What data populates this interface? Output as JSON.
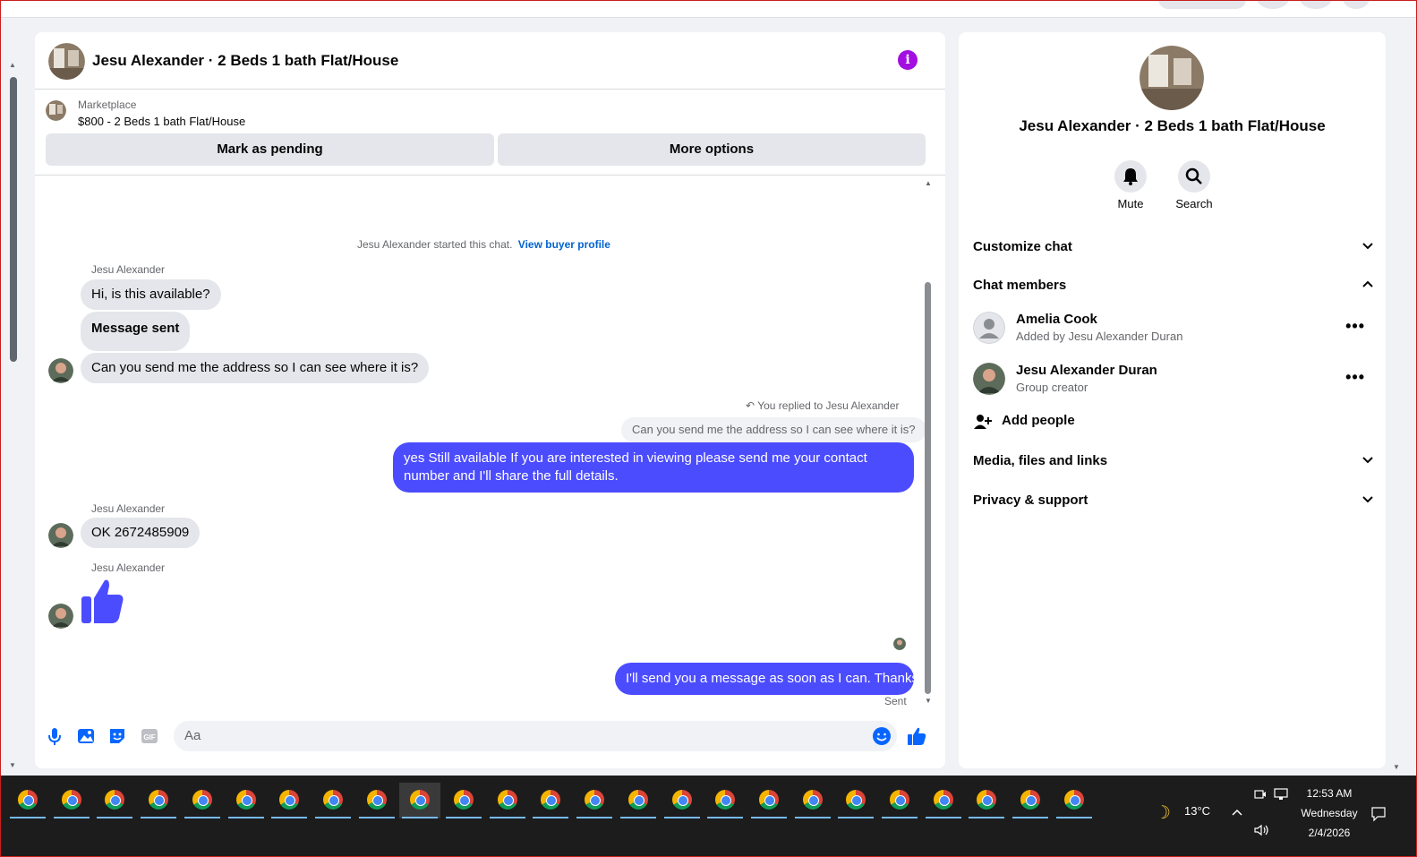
{
  "chat": {
    "title": "Jesu Alexander · 2 Beds 1 bath Flat/House",
    "listing_label": "Marketplace",
    "listing_title": "$800 - 2 Beds 1 bath Flat/House",
    "mark_pending": "Mark as pending",
    "more_options": "More options",
    "system_text": "Jesu Alexander started this chat.",
    "view_profile": "View buyer profile",
    "messages": {
      "sender1": "Jesu Alexander",
      "m1": "Hi, is this available?",
      "m2": "Message sent",
      "m3": "Can you send me the address so I can see where it is?",
      "reply_tag": "You replied to Jesu Alexander",
      "reply_quote": "Can you send me the address so I can see where it is?",
      "out1": "yes Still available If you are interested in viewing please send me your contact number and I'll share the full details.",
      "sender2": "Jesu Alexander",
      "m4": "OK 2672485909",
      "sender3": "Jesu Alexander",
      "out2": "I'll send you a message as soon as I can. Thanks",
      "sent_label": "Sent"
    },
    "composer_placeholder": "Aa"
  },
  "side": {
    "title": "Jesu Alexander · 2 Beds 1 bath Flat/House",
    "mute": "Mute",
    "search": "Search",
    "customize": "Customize chat",
    "members_header": "Chat members",
    "members": [
      {
        "name": "Amelia Cook",
        "sub": "Added by Jesu Alexander Duran"
      },
      {
        "name": "Jesu Alexander Duran",
        "sub": "Group creator"
      }
    ],
    "add_people": "Add people",
    "media": "Media, files and links",
    "privacy": "Privacy & support"
  },
  "taskbar": {
    "weather": "13°C",
    "time": "12:53 AM",
    "day": "Wednesday",
    "date": "2/4/2026"
  },
  "colors": {
    "accent_out": "#4c4cff",
    "info": "#a30fe0",
    "link": "#0064d1"
  }
}
